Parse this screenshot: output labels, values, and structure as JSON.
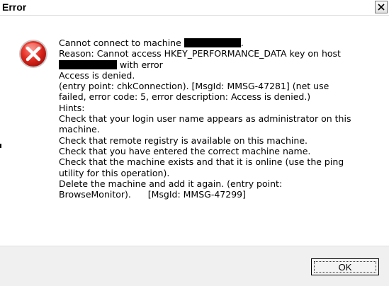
{
  "window": {
    "title": "Error",
    "close_icon": "close-icon"
  },
  "icon": {
    "name": "error-icon",
    "color": "#d32f2f"
  },
  "message": {
    "line1_prefix": "Cannot connect to machine",
    "line1_suffix": ".",
    "line2": "Reason: Cannot access HKEY_PERFORMANCE_DATA key on host",
    "line3_suffix": " with error",
    "line4": "Access is denied.",
    "line5": "(entry point: chkConnection). [MsgId: MMSG-47281] (net use",
    "line6": "failed, error code: 5, error description: Access is denied.)",
    "line7": "Hints:",
    "line8": "Check that your login user name appears as administrator on this",
    "line9": "machine.",
    "line10": "Check that remote registry is available on this machine.",
    "line11": "Check that you have entered the correct machine name.",
    "line12": "Check that the machine exists and that it is online (use the ping",
    "line13": "utility for this operation).",
    "line14": "Delete the machine and add it again. (entry point:",
    "line15": "BrowseMonitor).      [MsgId: MMSG-47299]"
  },
  "buttons": {
    "ok": "OK"
  }
}
